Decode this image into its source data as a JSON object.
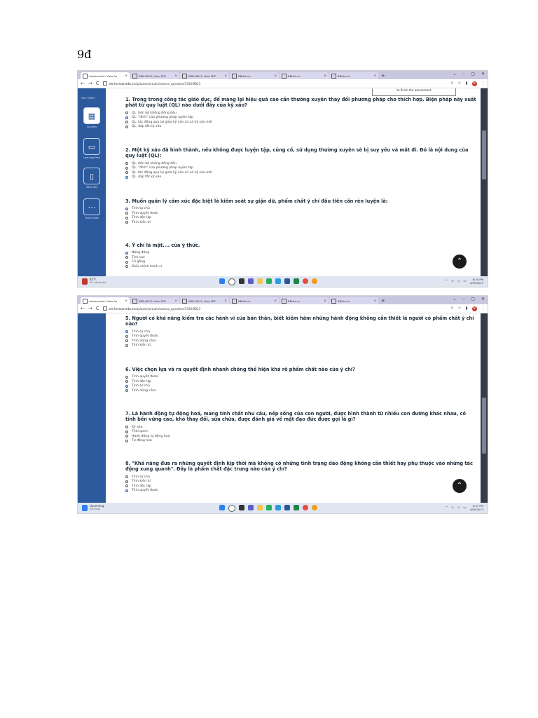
{
  "page": {
    "heading": "9đ"
  },
  "browser": {
    "tabs": [
      {
        "label": "Assessment: View As",
        "active": true
      },
      {
        "label": "KBB-HD13, Xem PDF",
        "active": false
      },
      {
        "label": "KBB-HD13, Xem PDF",
        "active": false
      },
      {
        "label": "BBUte.vn",
        "active": false
      },
      {
        "label": "BBUte.vn",
        "active": false
      },
      {
        "label": "BBUte.vn",
        "active": false
      }
    ],
    "new_tab": "+",
    "close_glyph": "×",
    "window_controls": [
      "⌄",
      "–",
      "▢",
      "✕"
    ],
    "url_host": "vle.hcmue.edu.vn",
    "url_path": "/quizzes/actuals/assess_question/3330/9823",
    "profile_initial": "N"
  },
  "sidebar": {
    "top_label": "Your Profile",
    "items": [
      {
        "label": "Courses",
        "glyph": "▦"
      },
      {
        "label": "Learning Plan",
        "glyph": "▭"
      },
      {
        "label": "eBox (IB)",
        "glyph": "▯"
      },
      {
        "label": "Thanh toán",
        "glyph": "⋯"
      }
    ]
  },
  "assessment": {
    "finish_note": "to finish the assessment",
    "questions": [
      {
        "text": "1. Trong trong công tác giáo dục, để mang lại hiệu quả cao cần thường xuyên thay đổi phương pháp cho thích hợp. Biện pháp này xuất phát từ quy luật (QL) nào dưới đây của kỹ xảo?",
        "options": [
          "QL. tiến bộ không đồng đều",
          "QL. \"đỉnh\" của phương pháp luyện tập",
          "QL. tác động qua lại giữa kỹ xảo cũ và kỹ xảo mới",
          "QL. dập tắt kỹ xảo"
        ],
        "selected": 1
      },
      {
        "text": "2. Một kỹ xảo đã hình thành, nếu không được luyện tập, củng cố, sử dụng thường xuyên sẽ bị suy yếu và mất đi. Đó là nội dung của quy luật (QL):",
        "options": [
          "QL. tiến bộ không đồng đều",
          "QL. \"đỉnh\" của phương pháp luyện tập",
          "QL. tác động qua lại giữa kỹ xảo cũ và kỹ xảo mới",
          "QL. dập tắt kỹ xảo"
        ],
        "selected": 3
      },
      {
        "text": "3. Muốn quản lý cảm xúc đặc biệt là kiềm soát sự giận dữ, phẩm chất ý chí đầu tiên cần rèn luyện là:",
        "options": [
          "Tính tự chủ",
          "Tính quyết đoán",
          "Tính độc lập",
          "Tính kiên trì"
        ],
        "selected": 0
      },
      {
        "text": "4. Ý chí là mặt.... của ý thức.",
        "options": [
          "Năng động",
          "Tích cực",
          "Cố gắng",
          "Điều chỉnh hành vi"
        ],
        "selected": 0
      },
      {
        "text": "5. Người có khả năng kiểm tra các hành vi của bản thân, biết kiềm hãm những hành động không cần thiết là người có phẩm chất ý chí nào?",
        "options": [
          "Tính tự chủ.",
          "Tính quyết đoán.",
          "Tính dũng cảm.",
          "Tính kiên trì."
        ],
        "selected": 0
      },
      {
        "text": "6. Việc chọn lựa và ra quyết định nhanh chóng thể hiện khá rõ phẩm chất nào của ý chí?",
        "options": [
          "Tính quyết đoán.",
          "Tính độc lập",
          "Tính tự chủ",
          "Tính dũng cảm."
        ],
        "selected": 2
      },
      {
        "text": "7. Là hành động tự động hoá, mang tính chất nhu cầu, nếp sống của con người, được hình thành từ nhiều con đường khác nhau, có tính bền vững cao, khó thay đổi, sửa chữa, được đánh giá về mặt đạo đức được gọi là gì?",
        "options": [
          "Kỹ xảo",
          "Thói quen",
          "Hành động tự động hoá",
          "Tự động hoá"
        ],
        "selected": 1
      },
      {
        "text": "8. \"Khả năng đưa ra những quyết định kịp thời mà không có những tình trạng dao động không cần thiết hay phụ thuộc vào những tác động xung quanh\". Đây là phẩm chất đặc trưng nào của ý chí?",
        "options": [
          "Tính tự chủ",
          "Tính kiên trì",
          "Tính độc lập",
          "Tính quyết đoán"
        ],
        "selected": 3
      }
    ]
  },
  "taskbar1": {
    "weather_temp": "82°F",
    "weather_desc": "Air: Moderate",
    "time": "8:34 PM",
    "date": "4/90/2023"
  },
  "taskbar2": {
    "weather_temp": "Upcoming",
    "weather_desc": "Earnings",
    "time": "8:37 PM",
    "date": "4/90/2023"
  },
  "colors": {
    "sidebar": "#2d5a9c",
    "tabbar": "#c9c7e0",
    "taskbar": "#dfe6f2"
  }
}
